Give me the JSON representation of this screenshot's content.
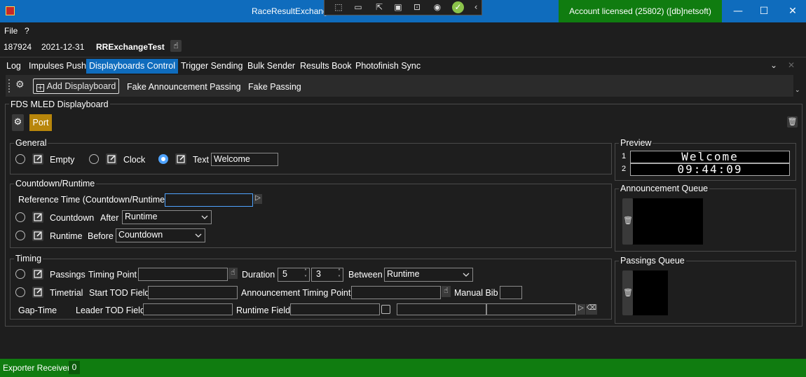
{
  "window": {
    "title": "RaceResultExchange",
    "license": "Account licensed (25802) ([db]netsoft)",
    "minimize": "—",
    "maximize": "☐",
    "close": "✕"
  },
  "menu": {
    "file": "File",
    "help": "?"
  },
  "info": {
    "number": "187924",
    "date": "2021-12-31",
    "name": "RRExchangeTest"
  },
  "tabs": [
    {
      "label": "Log"
    },
    {
      "label": "Impulses Push"
    },
    {
      "label": "Displayboards Control"
    },
    {
      "label": "Trigger Sending"
    },
    {
      "label": "Bulk Sender"
    },
    {
      "label": "Results Book"
    },
    {
      "label": "Photofinish Sync"
    }
  ],
  "toolbar": {
    "add_displayboard": "Add Displayboard",
    "fake_announcement": "Fake Announcement Passing",
    "fake_passing": "Fake Passing"
  },
  "board": {
    "title": "FDS MLED Displayboard",
    "port_label": "Port",
    "accent": "#b8860b"
  },
  "general": {
    "title": "General",
    "empty": "Empty",
    "clock": "Clock",
    "text": "Text",
    "text_value": "Welcome",
    "selected": "text"
  },
  "countdown": {
    "title": "Countdown/Runtime",
    "ref_time_label": "Reference Time (Countdown/Runtime)",
    "countdown_label": "Countdown",
    "after_label": "After",
    "after_value": "Runtime",
    "runtime_label": "Runtime",
    "before_label": "Before",
    "before_value": "Countdown"
  },
  "timing": {
    "title": "Timing",
    "passings_label": "Passings",
    "timing_point_label": "Timing Point",
    "duration_label": "Duration",
    "duration_a": "5",
    "duration_b": "3",
    "between_label": "Between",
    "between_value": "Runtime",
    "timetrial_label": "Timetrial",
    "start_tod_label": "Start TOD Field",
    "announcement_tp_label": "Announcement Timing Point",
    "manual_bib_label": "Manual Bib",
    "gap_time_label": "Gap-Time",
    "leader_tod_label": "Leader TOD Field",
    "runtime_field_label": "Runtime Field"
  },
  "preview": {
    "title": "Preview",
    "line1_no": "1",
    "line1": "Welcome",
    "line2_no": "2",
    "line2": "09:44:09"
  },
  "announcement_queue": {
    "title": "Announcement Queue"
  },
  "passings_queue": {
    "title": "Passings Queue"
  },
  "status": {
    "label": "Exporter Receiver",
    "count": "0"
  }
}
